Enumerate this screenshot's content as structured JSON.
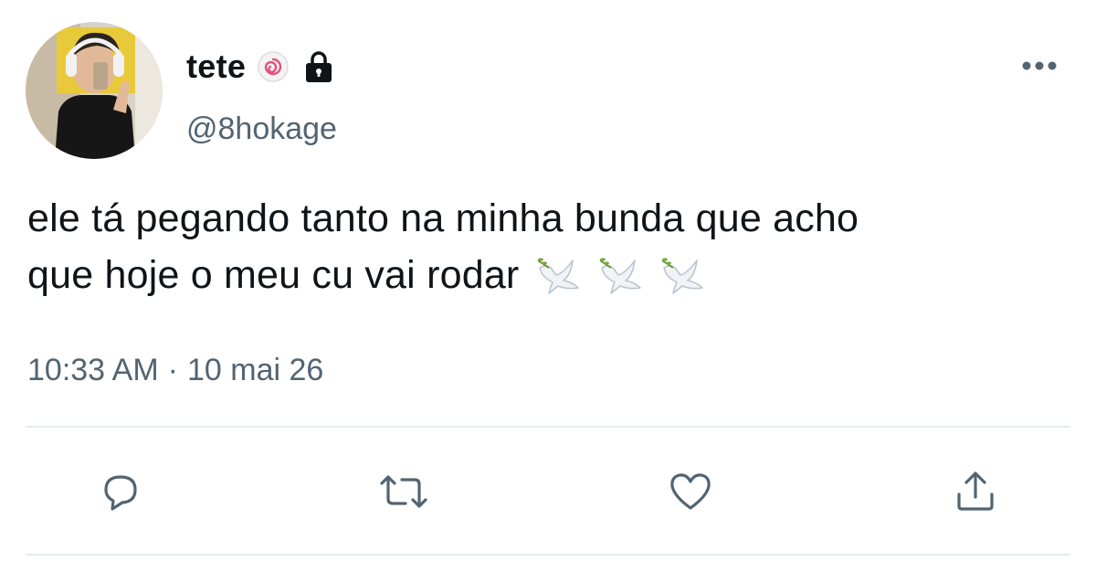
{
  "tweet": {
    "display_name": "tete",
    "handle": "@8hokage",
    "text_line1": "ele tá pegando tanto na minha bunda que acho",
    "text_line2": "que hoje o meu cu vai rodar",
    "time": "10:33 AM",
    "separator": "·",
    "date": "10 mai 26"
  },
  "icons": {
    "badge": "naruto-swirl-badge-icon",
    "lock": "lock-icon",
    "more": "more-options-icon",
    "dove": "dove-emoji-icon",
    "actions": [
      "reply-icon",
      "retweet-icon",
      "like-icon",
      "share-icon"
    ]
  },
  "colors": {
    "text": "#0f1419",
    "secondary": "#536471",
    "divider": "#e6ecf0"
  }
}
